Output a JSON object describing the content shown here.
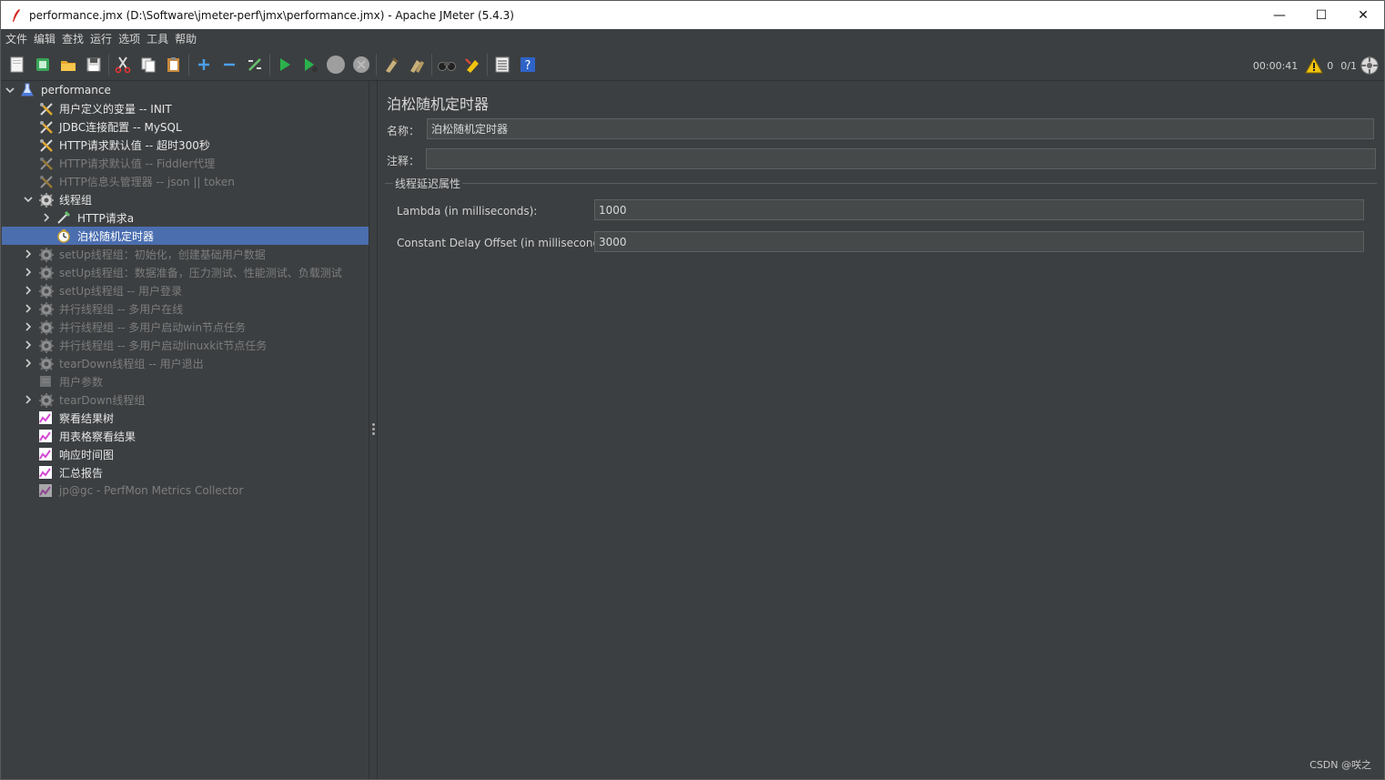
{
  "window": {
    "title": "performance.jmx (D:\\Software\\jmeter-perf\\jmx\\performance.jmx) - Apache JMeter (5.4.3)",
    "minimize": "—",
    "maximize": "☐",
    "close": "✕"
  },
  "menu": [
    "文件",
    "编辑",
    "查找",
    "运行",
    "选项",
    "工具",
    "帮助"
  ],
  "toolbar": {
    "timer": "00:00:41",
    "warnings": "0",
    "threads": "0/1"
  },
  "tree": [
    {
      "label": "performance",
      "enabled": true,
      "icon": "test-plan-icon",
      "expand": "open"
    },
    {
      "label": "用户定义的变量 -- INIT",
      "enabled": true,
      "icon": "config-icon"
    },
    {
      "label": "JDBC连接配置 -- MySQL",
      "enabled": true,
      "icon": "config-icon"
    },
    {
      "label": "HTTP请求默认值 -- 超时300秒",
      "enabled": true,
      "icon": "config-icon"
    },
    {
      "label": "HTTP请求默认值 -- Fiddler代理",
      "enabled": false,
      "icon": "config-icon"
    },
    {
      "label": "HTTP信息头管理器 -- json || token",
      "enabled": false,
      "icon": "config-icon"
    },
    {
      "label": "线程组",
      "enabled": true,
      "icon": "thread-group-icon",
      "expand": "open"
    },
    {
      "label": "HTTP请求a",
      "enabled": true,
      "icon": "sampler-icon",
      "expand": "closed"
    },
    {
      "label": "泊松随机定时器",
      "enabled": true,
      "icon": "timer-icon",
      "selected": true
    },
    {
      "label": "setUp线程组：初始化，创建基础用户数据",
      "enabled": false,
      "icon": "thread-group-icon",
      "expand": "closed"
    },
    {
      "label": "setUp线程组：数据准备，压力测试、性能测试、负载测试",
      "enabled": false,
      "icon": "thread-group-icon",
      "expand": "closed"
    },
    {
      "label": "setUp线程组 -- 用户登录",
      "enabled": false,
      "icon": "thread-group-icon",
      "expand": "closed"
    },
    {
      "label": "并行线程组 -- 多用户在线",
      "enabled": false,
      "icon": "thread-group-icon",
      "expand": "closed"
    },
    {
      "label": "并行线程组 -- 多用户启动win节点任务",
      "enabled": false,
      "icon": "thread-group-icon",
      "expand": "closed"
    },
    {
      "label": "并行线程组 -- 多用户启动linuxkit节点任务",
      "enabled": false,
      "icon": "thread-group-icon",
      "expand": "closed"
    },
    {
      "label": "tearDown线程组 -- 用户退出",
      "enabled": false,
      "icon": "thread-group-icon",
      "expand": "closed"
    },
    {
      "label": "用户参数",
      "enabled": false,
      "icon": "preprocessor-icon"
    },
    {
      "label": "tearDown线程组",
      "enabled": false,
      "icon": "thread-group-icon",
      "expand": "closed"
    },
    {
      "label": "察看结果树",
      "enabled": true,
      "icon": "listener-icon"
    },
    {
      "label": "用表格察看结果",
      "enabled": true,
      "icon": "listener-icon"
    },
    {
      "label": "响应时间图",
      "enabled": true,
      "icon": "listener-icon"
    },
    {
      "label": "汇总报告",
      "enabled": true,
      "icon": "listener-icon"
    },
    {
      "label": "jp@gc - PerfMon Metrics Collector",
      "enabled": false,
      "icon": "listener-icon"
    }
  ],
  "panel": {
    "title": "泊松随机定时器",
    "name_label": "名称：",
    "name_value": "泊松随机定时器",
    "comment_label": "注释：",
    "comment_value": "",
    "group_title": "线程延迟属性",
    "lambda_label": "Lambda (in milliseconds):",
    "lambda_value": "1000",
    "offset_label": "Constant Delay Offset (in milliseconds):",
    "offset_value": "3000"
  },
  "watermark": "CSDN @咲之"
}
